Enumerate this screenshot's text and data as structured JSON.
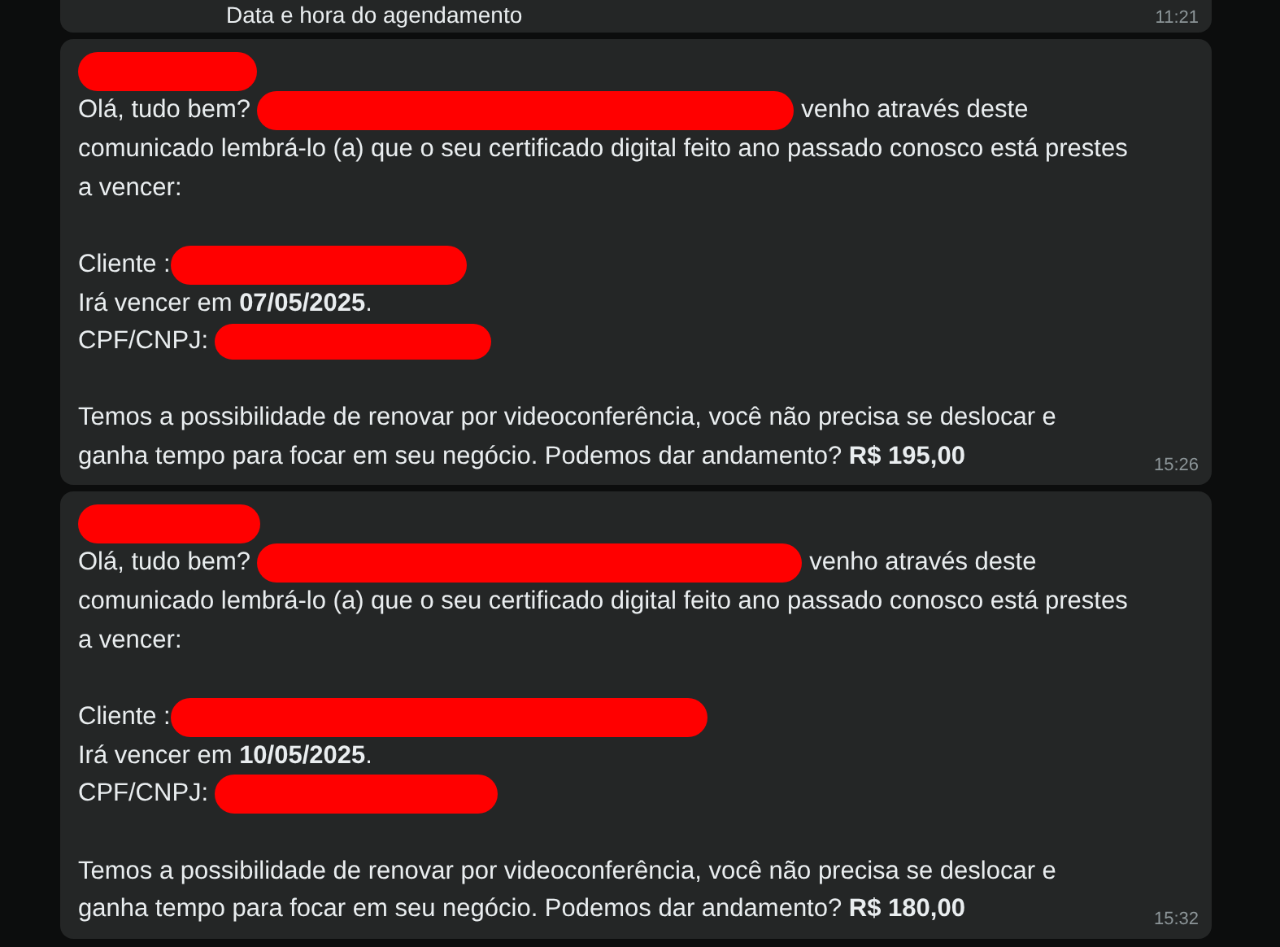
{
  "previous_message": {
    "text": "Data e hora do agendamento",
    "time": "11:21"
  },
  "messages": [
    {
      "greeting": "Olá, tudo bem?",
      "intro_lines": [
        "venho através deste",
        "comunicado lembrá-lo (a) que o seu certificado digital feito ano passado conosco está prestes a vencer:"
      ],
      "client_label": "Cliente :",
      "due": "Irá vencer em **07/05/2025**.",
      "id_label": "CPF/CNPJ:",
      "offer_lines": [
        "Temos a possibilidade de renovar por videoconferência, você não precisa se deslocar e",
        "ganha tempo para focar em seu negócio. Podemos dar andamento?"
      ],
      "price": "R$ 195,00",
      "time": "15:26"
    },
    {
      "greeting": "Olá, tudo bem?",
      "intro_lines": [
        "venho através deste",
        "comunicado lembrá-lo (a) que o seu certificado digital feito ano passado conosco está prestes a vencer:"
      ],
      "client_label": "Cliente :",
      "due": "Irá vencer em **10/05/2025**.",
      "id_label": "CPF/CNPJ:",
      "offer_lines": [
        "Temos a possibilidade de renovar por videoconferência, você não precisa se deslocar e",
        "ganha tempo para focar em seu negócio. Podemos dar andamento?"
      ],
      "price": "R$ 180,00",
      "time": "15:32"
    }
  ]
}
